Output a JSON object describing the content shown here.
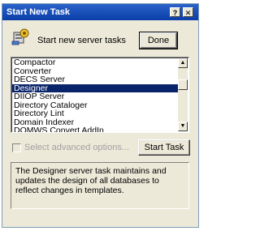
{
  "window": {
    "title": "Start New Task",
    "help_label": "?",
    "close_label": "✕"
  },
  "header": {
    "label": "Start new server tasks",
    "done_label": "Done",
    "icon": "server-task-icon"
  },
  "tasks": {
    "items": [
      "Compactor",
      "Converter",
      "DECS Server",
      "Designer",
      "DIIOP Server",
      "Directory Cataloger",
      "Directory Lint",
      "Domain Indexer",
      "DOMWS Convert AddIn"
    ],
    "selected_index": 3
  },
  "options": {
    "advanced_label": "Select advanced options...",
    "advanced_checked": false,
    "start_label": "Start Task"
  },
  "description": "The Designer server task maintains and updates the design of all databases to reflect changes in templates.",
  "colors": {
    "title_bar": "#0a3da8",
    "selection": "#0a246a",
    "dialog_bg": "#ece9d8"
  }
}
